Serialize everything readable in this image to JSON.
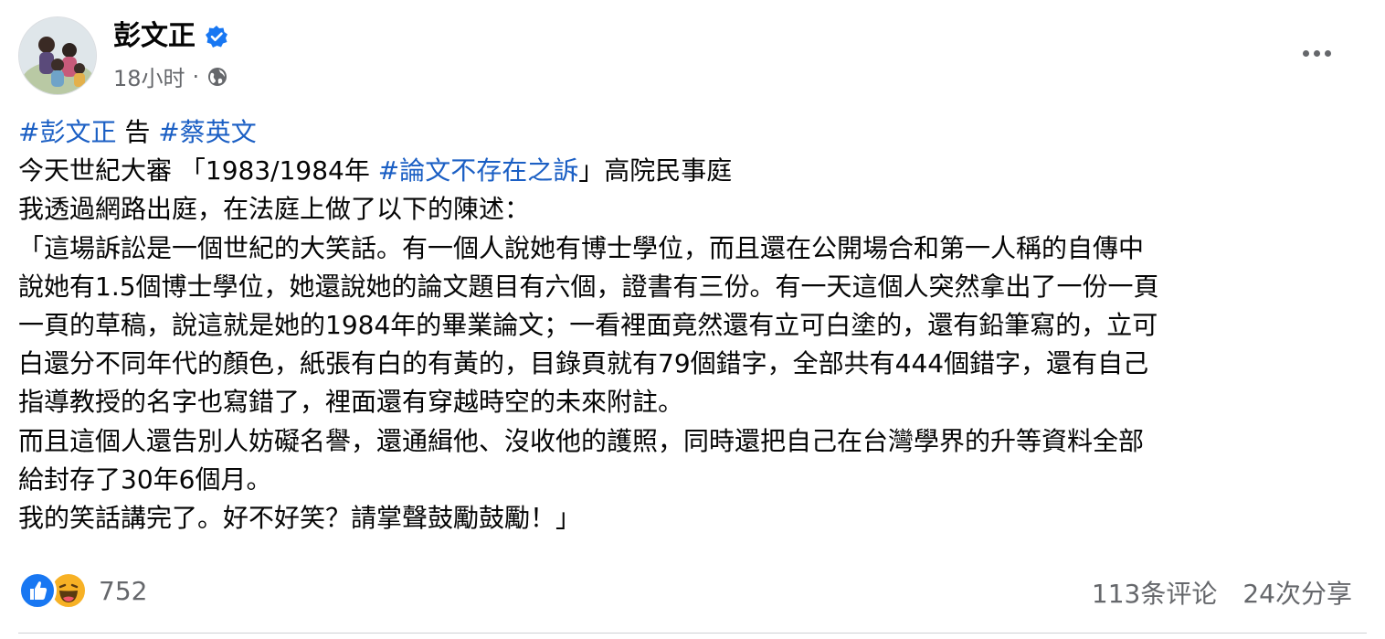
{
  "author": {
    "name": "彭文正",
    "verified": true,
    "timestamp": "18小时",
    "separator": "·",
    "audience_icon": "globe-icon"
  },
  "post": {
    "lines": [
      [
        {
          "type": "hashtag",
          "text": "#彭文正"
        },
        {
          "type": "text",
          "text": " 告 "
        },
        {
          "type": "hashtag",
          "text": "#蔡英文"
        }
      ],
      [
        {
          "type": "text",
          "text": "今天世紀大審 「1983/1984年 "
        },
        {
          "type": "hashtag",
          "text": "#論文不存在之訴"
        },
        {
          "type": "text",
          "text": "」高院民事庭"
        }
      ],
      [
        {
          "type": "text",
          "text": "我透過網路出庭，在法庭上做了以下的陳述："
        }
      ],
      [
        {
          "type": "text",
          "text": "「這場訴訟是一個世紀的大笑話。有一個人說她有博士學位，而且還在公開場合和第一人稱的自傳中"
        }
      ],
      [
        {
          "type": "text",
          "text": "說她有1.5個博士學位，她還說她的論文題目有六個，證書有三份。有一天這個人突然拿出了一份一頁"
        }
      ],
      [
        {
          "type": "text",
          "text": "一頁的草稿，說這就是她的1984年的畢業論文；一看裡面竟然還有立可白塗的，還有鉛筆寫的，立可"
        }
      ],
      [
        {
          "type": "text",
          "text": "白還分不同年代的顏色，紙張有白的有黃的，目錄頁就有79個錯字，全部共有444個錯字，還有自己"
        }
      ],
      [
        {
          "type": "text",
          "text": "指導教授的名字也寫錯了，裡面還有穿越時空的未來附註。"
        }
      ],
      [
        {
          "type": "text",
          "text": "而且這個人還告別人妨礙名譽，還通緝他、沒收他的護照，同時還把自己在台灣學界的升等資料全部"
        }
      ],
      [
        {
          "type": "text",
          "text": "給封存了30年6個月。"
        }
      ],
      [
        {
          "type": "text",
          "text": "我的笑話講完了。好不好笑？請掌聲鼓勵鼓勵！」"
        }
      ]
    ]
  },
  "footer": {
    "reaction_icons": [
      "like-icon",
      "haha-icon"
    ],
    "reaction_count": "752",
    "comments": "113条评论",
    "shares": "24次分享"
  },
  "colors": {
    "hashtag": "#1b5fc4",
    "meta": "#65676b",
    "like": "#1877f2",
    "haha": "#f7b125",
    "verified": "#1877f2"
  }
}
